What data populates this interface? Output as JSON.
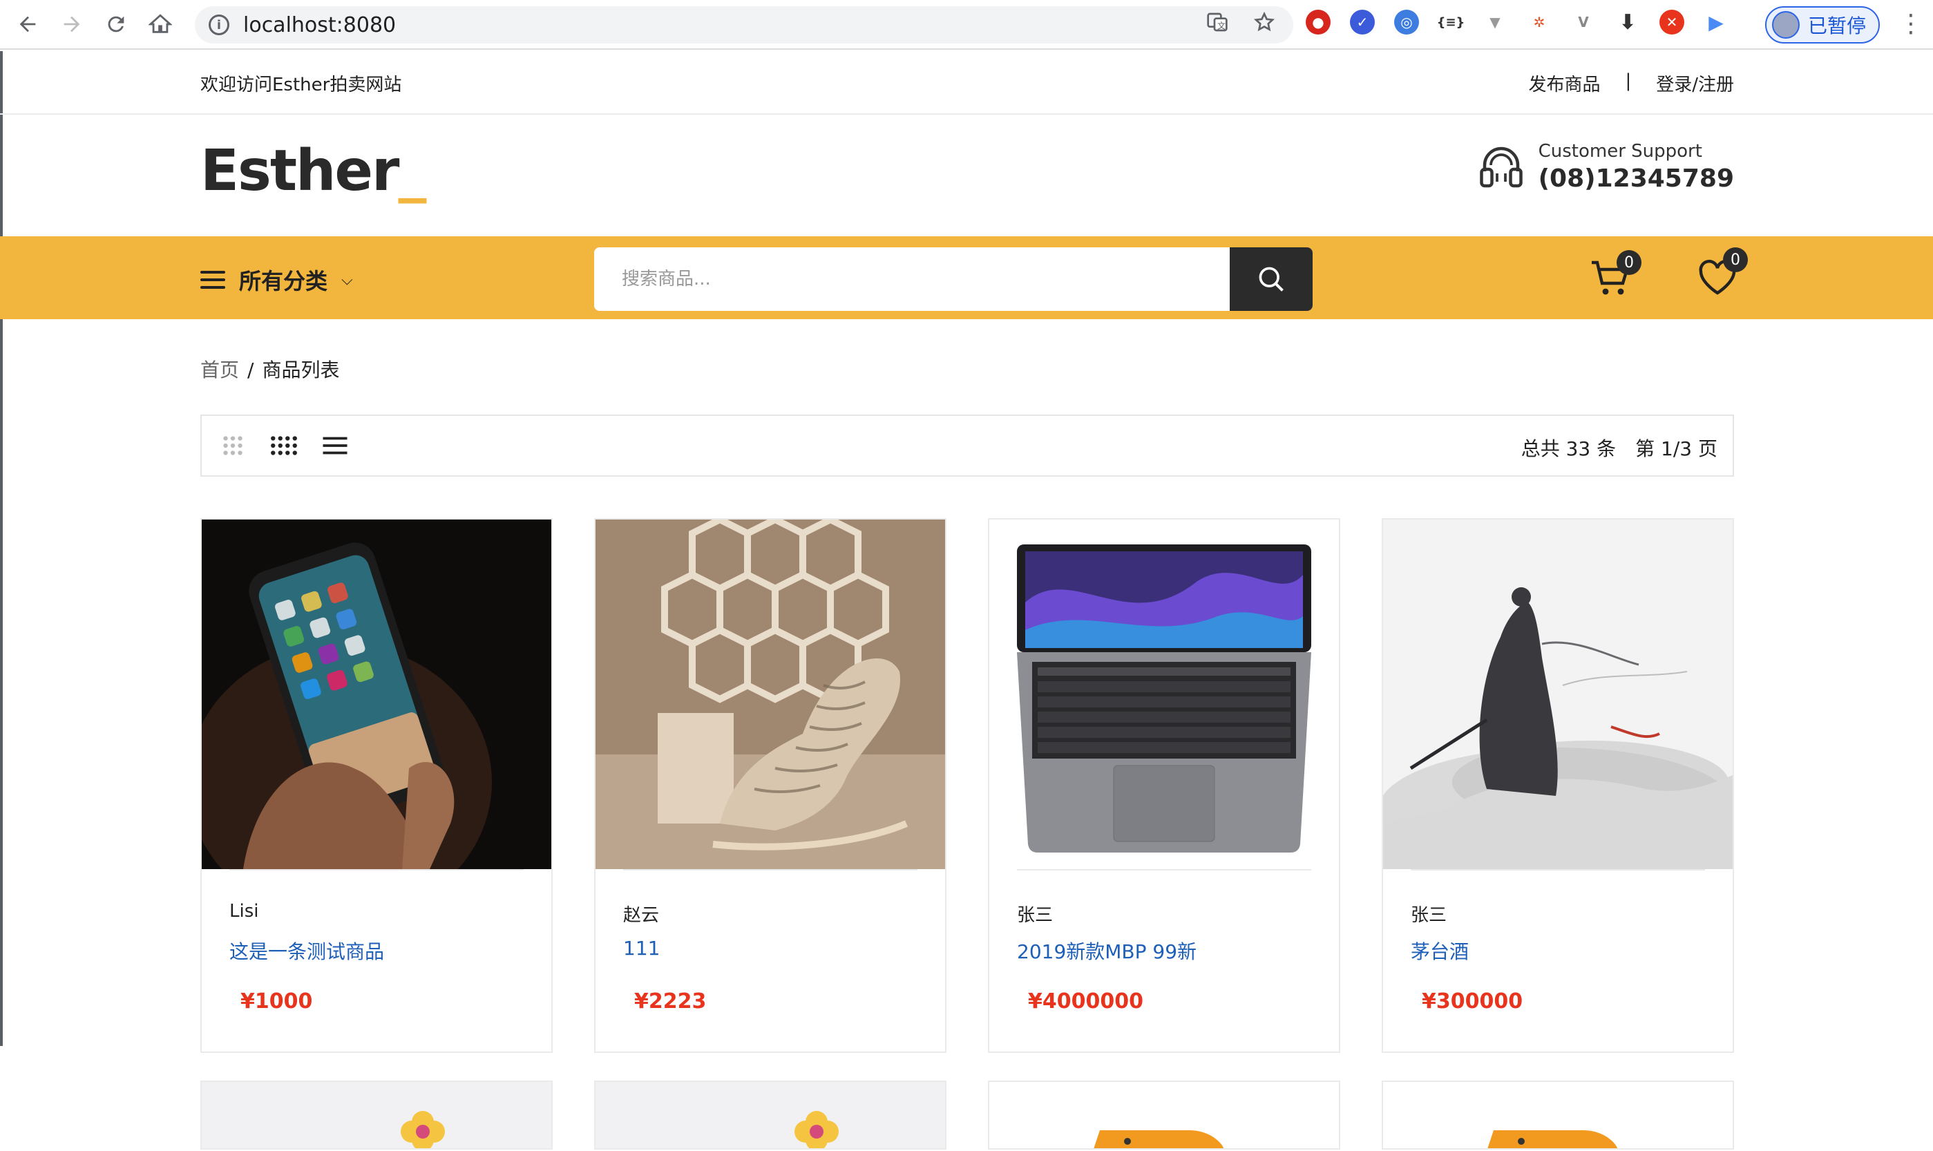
{
  "browser": {
    "url": "localhost:8080",
    "profile_label": "已暂停",
    "icons": [
      "back-icon",
      "forward-icon",
      "reload-icon",
      "home-icon",
      "translate-icon",
      "star-icon"
    ]
  },
  "topbar": {
    "welcome": "欢迎访问Esther拍卖网站",
    "publish": "发布商品",
    "separator": "|",
    "login": "登录/注册"
  },
  "header": {
    "logo": "Esther",
    "logo_suffix": "_",
    "support_label": "Customer Support",
    "support_phone": "(08)12345789"
  },
  "catbar": {
    "all_categories": "所有分类",
    "search_placeholder": "搜索商品...",
    "cart_count": "0",
    "wishlist_count": "0"
  },
  "breadcrumb": {
    "home": "首页",
    "separator": "/",
    "current": "商品列表"
  },
  "toolbar": {
    "total": "总共 33 条",
    "page": "第 1/3 页"
  },
  "products": [
    {
      "seller": "Lisi",
      "title": "这是一条测试商品",
      "price": "¥1000",
      "image": "phone-in-hand"
    },
    {
      "seller": "赵云",
      "title": "111",
      "price": "¥2223",
      "image": "rocking-chair"
    },
    {
      "seller": "张三",
      "title": "2019新款MBP 99新",
      "price": "¥4000000",
      "image": "macbook-pro"
    },
    {
      "seller": "张三",
      "title": "茅台酒",
      "price": "¥300000",
      "image": "ink-swordsman"
    }
  ],
  "colors": {
    "accent": "#f2b53d",
    "link": "#1e5fb8",
    "price": "#e8341c",
    "dark": "#2b2b2b"
  }
}
